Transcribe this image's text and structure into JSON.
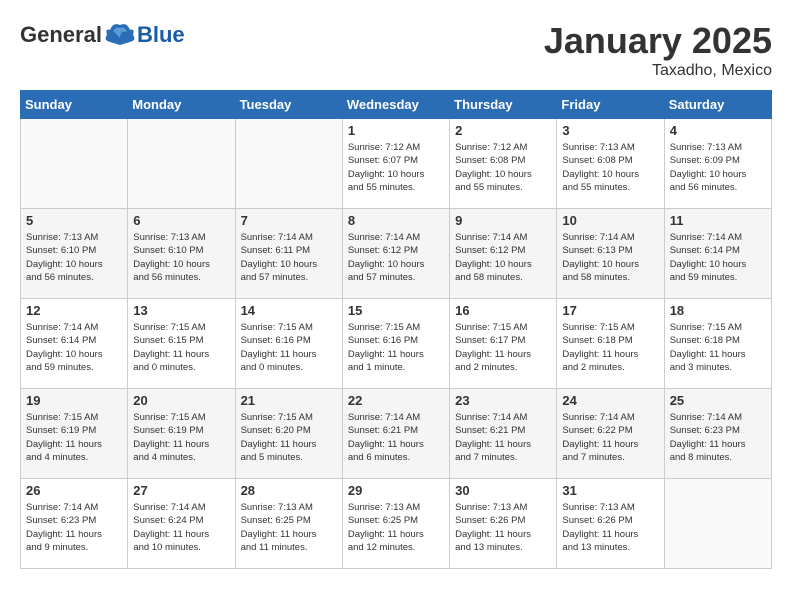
{
  "header": {
    "logo": {
      "general": "General",
      "blue": "Blue"
    },
    "title": "January 2025",
    "subtitle": "Taxadho, Mexico"
  },
  "weekdays": [
    "Sunday",
    "Monday",
    "Tuesday",
    "Wednesday",
    "Thursday",
    "Friday",
    "Saturday"
  ],
  "weeks": [
    [
      {
        "day": "",
        "info": ""
      },
      {
        "day": "",
        "info": ""
      },
      {
        "day": "",
        "info": ""
      },
      {
        "day": "1",
        "info": "Sunrise: 7:12 AM\nSunset: 6:07 PM\nDaylight: 10 hours\nand 55 minutes."
      },
      {
        "day": "2",
        "info": "Sunrise: 7:12 AM\nSunset: 6:08 PM\nDaylight: 10 hours\nand 55 minutes."
      },
      {
        "day": "3",
        "info": "Sunrise: 7:13 AM\nSunset: 6:08 PM\nDaylight: 10 hours\nand 55 minutes."
      },
      {
        "day": "4",
        "info": "Sunrise: 7:13 AM\nSunset: 6:09 PM\nDaylight: 10 hours\nand 56 minutes."
      }
    ],
    [
      {
        "day": "5",
        "info": "Sunrise: 7:13 AM\nSunset: 6:10 PM\nDaylight: 10 hours\nand 56 minutes."
      },
      {
        "day": "6",
        "info": "Sunrise: 7:13 AM\nSunset: 6:10 PM\nDaylight: 10 hours\nand 56 minutes."
      },
      {
        "day": "7",
        "info": "Sunrise: 7:14 AM\nSunset: 6:11 PM\nDaylight: 10 hours\nand 57 minutes."
      },
      {
        "day": "8",
        "info": "Sunrise: 7:14 AM\nSunset: 6:12 PM\nDaylight: 10 hours\nand 57 minutes."
      },
      {
        "day": "9",
        "info": "Sunrise: 7:14 AM\nSunset: 6:12 PM\nDaylight: 10 hours\nand 58 minutes."
      },
      {
        "day": "10",
        "info": "Sunrise: 7:14 AM\nSunset: 6:13 PM\nDaylight: 10 hours\nand 58 minutes."
      },
      {
        "day": "11",
        "info": "Sunrise: 7:14 AM\nSunset: 6:14 PM\nDaylight: 10 hours\nand 59 minutes."
      }
    ],
    [
      {
        "day": "12",
        "info": "Sunrise: 7:14 AM\nSunset: 6:14 PM\nDaylight: 10 hours\nand 59 minutes."
      },
      {
        "day": "13",
        "info": "Sunrise: 7:15 AM\nSunset: 6:15 PM\nDaylight: 11 hours\nand 0 minutes."
      },
      {
        "day": "14",
        "info": "Sunrise: 7:15 AM\nSunset: 6:16 PM\nDaylight: 11 hours\nand 0 minutes."
      },
      {
        "day": "15",
        "info": "Sunrise: 7:15 AM\nSunset: 6:16 PM\nDaylight: 11 hours\nand 1 minute."
      },
      {
        "day": "16",
        "info": "Sunrise: 7:15 AM\nSunset: 6:17 PM\nDaylight: 11 hours\nand 2 minutes."
      },
      {
        "day": "17",
        "info": "Sunrise: 7:15 AM\nSunset: 6:18 PM\nDaylight: 11 hours\nand 2 minutes."
      },
      {
        "day": "18",
        "info": "Sunrise: 7:15 AM\nSunset: 6:18 PM\nDaylight: 11 hours\nand 3 minutes."
      }
    ],
    [
      {
        "day": "19",
        "info": "Sunrise: 7:15 AM\nSunset: 6:19 PM\nDaylight: 11 hours\nand 4 minutes."
      },
      {
        "day": "20",
        "info": "Sunrise: 7:15 AM\nSunset: 6:19 PM\nDaylight: 11 hours\nand 4 minutes."
      },
      {
        "day": "21",
        "info": "Sunrise: 7:15 AM\nSunset: 6:20 PM\nDaylight: 11 hours\nand 5 minutes."
      },
      {
        "day": "22",
        "info": "Sunrise: 7:14 AM\nSunset: 6:21 PM\nDaylight: 11 hours\nand 6 minutes."
      },
      {
        "day": "23",
        "info": "Sunrise: 7:14 AM\nSunset: 6:21 PM\nDaylight: 11 hours\nand 7 minutes."
      },
      {
        "day": "24",
        "info": "Sunrise: 7:14 AM\nSunset: 6:22 PM\nDaylight: 11 hours\nand 7 minutes."
      },
      {
        "day": "25",
        "info": "Sunrise: 7:14 AM\nSunset: 6:23 PM\nDaylight: 11 hours\nand 8 minutes."
      }
    ],
    [
      {
        "day": "26",
        "info": "Sunrise: 7:14 AM\nSunset: 6:23 PM\nDaylight: 11 hours\nand 9 minutes."
      },
      {
        "day": "27",
        "info": "Sunrise: 7:14 AM\nSunset: 6:24 PM\nDaylight: 11 hours\nand 10 minutes."
      },
      {
        "day": "28",
        "info": "Sunrise: 7:13 AM\nSunset: 6:25 PM\nDaylight: 11 hours\nand 11 minutes."
      },
      {
        "day": "29",
        "info": "Sunrise: 7:13 AM\nSunset: 6:25 PM\nDaylight: 11 hours\nand 12 minutes."
      },
      {
        "day": "30",
        "info": "Sunrise: 7:13 AM\nSunset: 6:26 PM\nDaylight: 11 hours\nand 13 minutes."
      },
      {
        "day": "31",
        "info": "Sunrise: 7:13 AM\nSunset: 6:26 PM\nDaylight: 11 hours\nand 13 minutes."
      },
      {
        "day": "",
        "info": ""
      }
    ]
  ]
}
